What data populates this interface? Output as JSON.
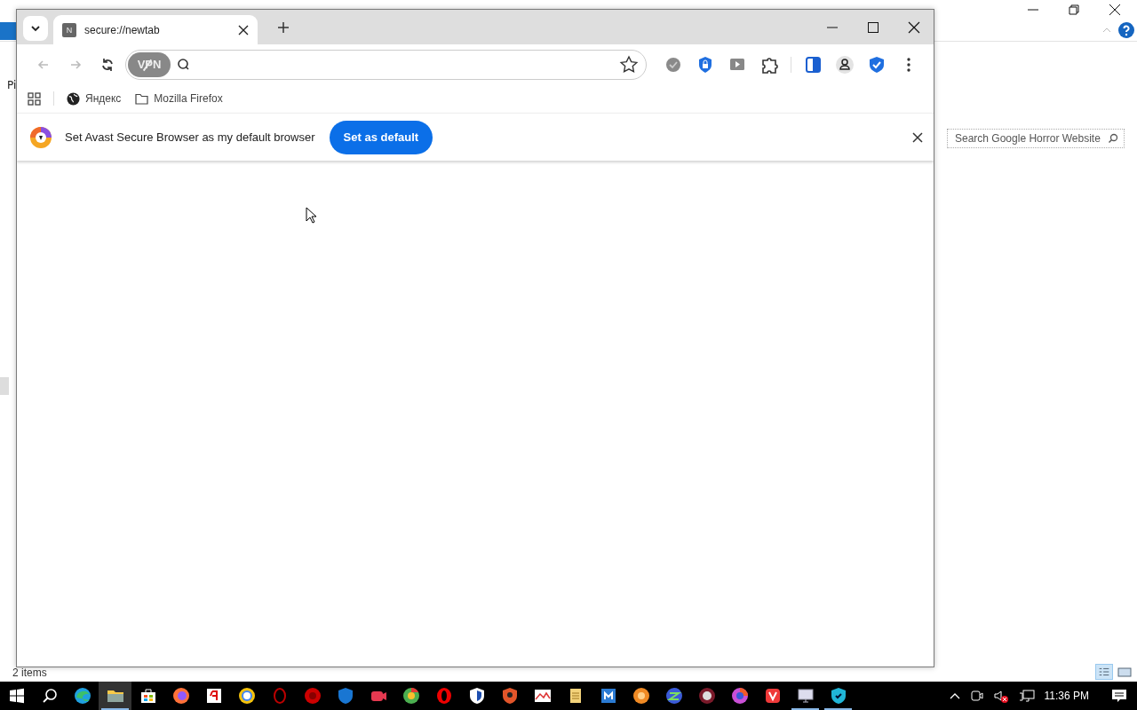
{
  "background_window": {
    "partial_label": "Pi",
    "search": {
      "placeholder": "Search Google Horror Website"
    },
    "status_bar": "2 items"
  },
  "browser": {
    "tabs": [
      {
        "favicon": "N",
        "title": "secure://newtab",
        "selected": true
      }
    ],
    "address_bar": {
      "vpn_badge": "VPN",
      "vpn_on": false
    },
    "bookmarks": [
      {
        "kind": "site",
        "label": "Яндекс"
      },
      {
        "kind": "folder",
        "label": "Mozilla Firefox"
      }
    ],
    "infobar": {
      "message": "Set Avast Secure Browser as my default browser",
      "button": "Set as default"
    }
  },
  "taskbar": {
    "apps": [
      {
        "running": false,
        "selected": false
      },
      {
        "running": true,
        "selected": true
      },
      {
        "running": false,
        "selected": false
      },
      {
        "running": false,
        "selected": false
      },
      {
        "running": false,
        "selected": false
      },
      {
        "running": false,
        "selected": false
      },
      {
        "running": false,
        "selected": false
      },
      {
        "running": false,
        "selected": false
      },
      {
        "running": false,
        "selected": false
      },
      {
        "running": false,
        "selected": false
      },
      {
        "running": false,
        "selected": false
      },
      {
        "running": false,
        "selected": false
      },
      {
        "running": false,
        "selected": false
      },
      {
        "running": false,
        "selected": false
      },
      {
        "running": false,
        "selected": false
      },
      {
        "running": false,
        "selected": false
      },
      {
        "running": false,
        "selected": false
      },
      {
        "running": false,
        "selected": false
      },
      {
        "running": false,
        "selected": false
      },
      {
        "running": false,
        "selected": false
      },
      {
        "running": false,
        "selected": false
      },
      {
        "running": false,
        "selected": false
      },
      {
        "running": true,
        "selected": false
      },
      {
        "running": true,
        "selected": false
      }
    ],
    "clock": "11:36 PM"
  }
}
